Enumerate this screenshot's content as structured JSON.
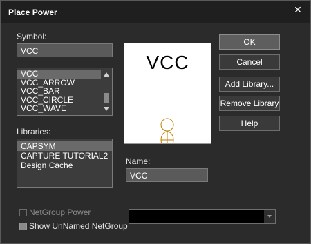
{
  "window": {
    "title": "Place Power",
    "close_glyph": "✕"
  },
  "symbol": {
    "label": "Symbol:",
    "value": "VCC"
  },
  "symbol_list": {
    "items": [
      "VCC",
      "VCC_ARROW",
      "VCC_BAR",
      "VCC_CIRCLE",
      "VCC_WAVE"
    ],
    "selected_index": 0
  },
  "libraries": {
    "label": "Libraries:",
    "items": [
      "CAPSYM",
      "CAPTURE TUTORIAL2",
      "Design Cache"
    ],
    "selected_index": 0
  },
  "preview": {
    "text": "VCC",
    "accent_color": "#c08000"
  },
  "name": {
    "label": "Name:",
    "value": "VCC"
  },
  "buttons": {
    "ok": "OK",
    "cancel": "Cancel",
    "add_library": "Add Library...",
    "remove_library": "Remove Library",
    "help": "Help"
  },
  "options": {
    "netgroup_power": {
      "label": "NetGroup Power",
      "checked": false,
      "enabled": false
    },
    "show_unnamed_netgroup": {
      "label": "Show UnNamed NetGroup",
      "checked": true,
      "enabled": true
    }
  },
  "netgroup_combo": {
    "value": ""
  },
  "colors": {
    "background": "#2b2b2b",
    "titlebar": "#1f1f1f",
    "field": "#5a5a5a",
    "list": "#3c3c3c"
  }
}
